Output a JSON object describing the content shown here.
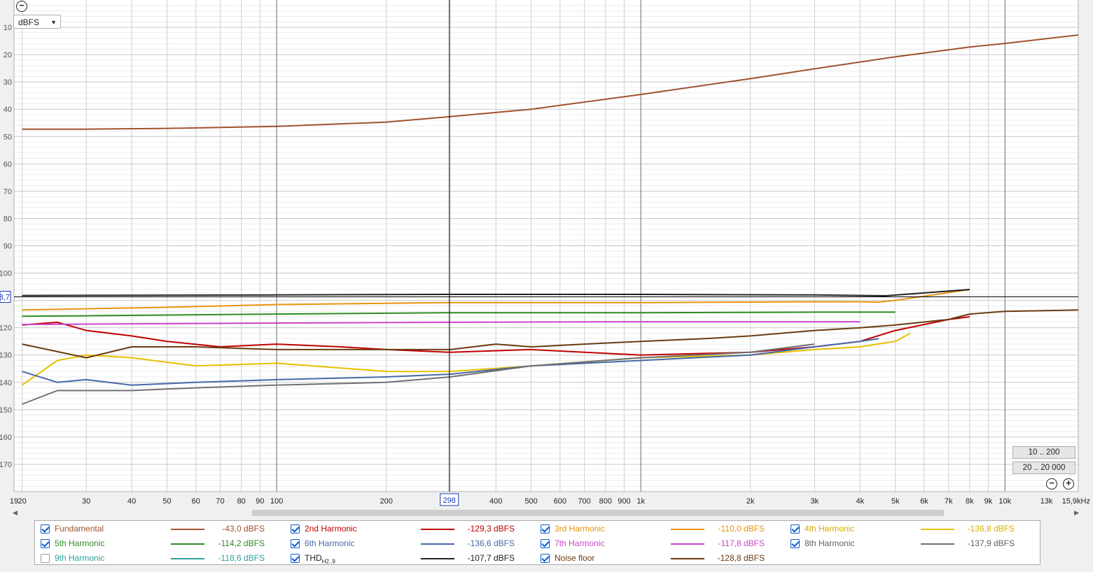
{
  "chart_data": {
    "type": "line",
    "x_scale": "log",
    "xlim": [
      19,
      15900
    ],
    "ylim": [
      -180,
      0
    ],
    "y_unit": "dBFS",
    "grid": true,
    "x_ticks": [
      {
        "v": 19,
        "label": "19"
      },
      {
        "v": 20,
        "label": "20"
      },
      {
        "v": 30,
        "label": "30"
      },
      {
        "v": 40,
        "label": "40"
      },
      {
        "v": 50,
        "label": "50"
      },
      {
        "v": 60,
        "label": "60"
      },
      {
        "v": 70,
        "label": "70"
      },
      {
        "v": 80,
        "label": "80"
      },
      {
        "v": 90,
        "label": "90"
      },
      {
        "v": 100,
        "label": "100"
      },
      {
        "v": 200,
        "label": "200"
      },
      {
        "v": 400,
        "label": "400"
      },
      {
        "v": 500,
        "label": "500"
      },
      {
        "v": 600,
        "label": "600"
      },
      {
        "v": 700,
        "label": "700"
      },
      {
        "v": 800,
        "label": "800"
      },
      {
        "v": 900,
        "label": "900"
      },
      {
        "v": 1000,
        "label": "1k"
      },
      {
        "v": 2000,
        "label": "2k"
      },
      {
        "v": 3000,
        "label": "3k"
      },
      {
        "v": 4000,
        "label": "4k"
      },
      {
        "v": 5000,
        "label": "5k"
      },
      {
        "v": 6000,
        "label": "6k"
      },
      {
        "v": 7000,
        "label": "7k"
      },
      {
        "v": 8000,
        "label": "8k"
      },
      {
        "v": 9000,
        "label": "9k"
      },
      {
        "v": 10000,
        "label": "10k"
      },
      {
        "v": 13000,
        "label": "13k"
      },
      {
        "v": 15900,
        "label": "15,9kHz"
      }
    ],
    "y_ticks": [
      {
        "v": -10,
        "label": "10"
      },
      {
        "v": -20,
        "label": "20"
      },
      {
        "v": -30,
        "label": "30"
      },
      {
        "v": -40,
        "label": "40"
      },
      {
        "v": -50,
        "label": "50"
      },
      {
        "v": -60,
        "label": "60"
      },
      {
        "v": -70,
        "label": "70"
      },
      {
        "v": -80,
        "label": "80"
      },
      {
        "v": -90,
        "label": "90"
      },
      {
        "v": -100,
        "label": "100"
      },
      {
        "v": -120,
        "label": "120"
      },
      {
        "v": -130,
        "label": "130"
      },
      {
        "v": -140,
        "label": "140"
      },
      {
        "v": -150,
        "label": "150"
      },
      {
        "v": -160,
        "label": "160"
      },
      {
        "v": -170,
        "label": "170"
      }
    ],
    "cursor": {
      "x": 298,
      "x_label": "298",
      "y": -108.7,
      "y_label": "8,7"
    },
    "series": [
      {
        "name": "Fundamental",
        "color": "#a0522d",
        "visible": true,
        "x": [
          20,
          30,
          50,
          100,
          200,
          300,
          500,
          1000,
          2000,
          3000,
          5000,
          8000,
          10000,
          15900
        ],
        "y": [
          -47.3,
          -47.3,
          -47,
          -46.3,
          -44.7,
          -42.7,
          -40,
          -34.6,
          -28.8,
          -25.2,
          -20.8,
          -17.2,
          -15.9,
          -12.8
        ]
      },
      {
        "name": "2nd Harmonic",
        "color": "#c00000",
        "visible": true,
        "x": [
          20,
          25,
          30,
          40,
          50,
          70,
          100,
          150,
          200,
          300,
          500,
          1000,
          2000,
          3000,
          4000,
          5000,
          7000,
          8000
        ],
        "y": [
          -119,
          -118,
          -121,
          -123,
          -125,
          -127,
          -126,
          -127,
          -128,
          -129,
          -128,
          -130,
          -129,
          -127,
          -125,
          -121,
          -117,
          -116
        ]
      },
      {
        "name": "3rd Harmonic",
        "color": "#e8940c",
        "visible": true,
        "x": [
          20,
          50,
          100,
          300,
          1000,
          3000,
          4000,
          4500,
          5000,
          8000
        ],
        "y": [
          -113.5,
          -112.5,
          -111.5,
          -110.8,
          -110.8,
          -110.5,
          -110.5,
          -110.6,
          -110,
          -106
        ]
      },
      {
        "name": "4th Harmonic",
        "color": "#e6c000",
        "visible": true,
        "x": [
          20,
          25,
          30,
          40,
          60,
          100,
          200,
          300,
          500,
          1000,
          2000,
          3000,
          4000,
          5000,
          5500
        ],
        "y": [
          -141,
          -132,
          -130,
          -131,
          -134,
          -133,
          -136,
          -136,
          -134,
          -131,
          -130,
          -128,
          -127,
          -125,
          -122
        ]
      },
      {
        "name": "5th Harmonic",
        "color": "#2e8b22",
        "visible": true,
        "x": [
          20,
          100,
          300,
          1000,
          3000,
          5000
        ],
        "y": [
          -115.8,
          -115,
          -114.5,
          -114.5,
          -114.3,
          -114.3
        ]
      },
      {
        "name": "6th Harmonic",
        "color": "#4669a8",
        "visible": true,
        "x": [
          20,
          25,
          30,
          40,
          60,
          100,
          200,
          300,
          500,
          1000,
          2000,
          3000,
          4000,
          4500
        ],
        "y": [
          -136,
          -140,
          -139,
          -141,
          -140,
          -139,
          -138,
          -137,
          -134,
          -132,
          -130,
          -127,
          -125,
          -124
        ]
      },
      {
        "name": "7th Harmonic",
        "color": "#cc44cc",
        "visible": true,
        "x": [
          20,
          100,
          300,
          1000,
          3000,
          4000
        ],
        "y": [
          -118.8,
          -118.3,
          -118,
          -117.8,
          -117.8,
          -117.8
        ]
      },
      {
        "name": "8th Harmonic",
        "color": "#707070",
        "visible": true,
        "x": [
          20,
          25,
          30,
          40,
          60,
          100,
          200,
          300,
          500,
          1000,
          2000,
          3000
        ],
        "y": [
          -148,
          -143,
          -143,
          -143,
          -142,
          -141,
          -140,
          -138,
          -134,
          -131,
          -129,
          -126
        ]
      },
      {
        "name": "9th Harmonic",
        "color": "#2ea0a0",
        "visible": false,
        "x": [
          20,
          1000
        ],
        "y": [
          -118.6,
          -118.6
        ]
      },
      {
        "name": "THD H2..9",
        "color": "#202020",
        "visible": true,
        "x": [
          20,
          100,
          300,
          1000,
          3000,
          4700,
          8000
        ],
        "y": [
          -108.2,
          -108,
          -107.8,
          -107.8,
          -108,
          -108.3,
          -106
        ]
      },
      {
        "name": "Noise floor",
        "color": "#6b3a10",
        "visible": true,
        "x": [
          20,
          30,
          40,
          60,
          100,
          150,
          200,
          300,
          400,
          500,
          700,
          1000,
          1500,
          2000,
          3000,
          4000,
          5000,
          7000,
          8000,
          10000,
          15900
        ],
        "y": [
          -126,
          -131,
          -127,
          -127,
          -128,
          -128,
          -128,
          -128,
          -126,
          -127,
          -126,
          -125,
          -124,
          -123,
          -121,
          -120,
          -119,
          -117,
          -115,
          -114,
          -113.5
        ]
      }
    ]
  },
  "ui": {
    "unit_select": "dBFS",
    "zoom_out_top": "−",
    "zoom_out": "−",
    "zoom_in": "+",
    "range_buttons": [
      "10 .. 200",
      "20 .. 20 000"
    ],
    "scroll_left": "◀",
    "scroll_right": "▶"
  },
  "legend": [
    {
      "name": "Fundamental",
      "sub": "",
      "value": "-43,0 dBFS",
      "color": "#a0522d",
      "text_color": "#a0522d",
      "checked": true
    },
    {
      "name": "2nd Harmonic",
      "sub": "",
      "value": "-129,3 dBFS",
      "color": "#c00000",
      "text_color": "#c00000",
      "checked": true
    },
    {
      "name": "3rd Harmonic",
      "sub": "",
      "value": "-110,0 dBFS",
      "color": "#e8940c",
      "text_color": "#e8940c",
      "checked": true
    },
    {
      "name": "4th Harmonic",
      "sub": "",
      "value": "-136,8 dBFS",
      "color": "#e6c000",
      "text_color": "#d6b000",
      "checked": true
    },
    {
      "name": "5th Harmonic",
      "sub": "",
      "value": "-114,2 dBFS",
      "color": "#2e8b22",
      "text_color": "#2e8b22",
      "checked": true
    },
    {
      "name": "6th Harmonic",
      "sub": "",
      "value": "-136,6 dBFS",
      "color": "#4669a8",
      "text_color": "#4669a8",
      "checked": true
    },
    {
      "name": "7th Harmonic",
      "sub": "",
      "value": "-117,8 dBFS",
      "color": "#cc44cc",
      "text_color": "#cc44cc",
      "checked": true
    },
    {
      "name": "8th Harmonic",
      "sub": "",
      "value": "-137,9 dBFS",
      "color": "#707070",
      "text_color": "#606060",
      "checked": true
    },
    {
      "name": "9th Harmonic",
      "sub": "",
      "value": "-118,6 dBFS",
      "color": "#2ea0a0",
      "text_color": "#2ea0a0",
      "checked": false
    },
    {
      "name": "THD",
      "sub": "H2..9",
      "value": "-107,7 dBFS",
      "color": "#202020",
      "text_color": "#202020",
      "checked": true
    },
    {
      "name": "Noise floor",
      "sub": "",
      "value": "-128,8 dBFS",
      "color": "#6b3a10",
      "text_color": "#6b3a10",
      "checked": true
    }
  ]
}
